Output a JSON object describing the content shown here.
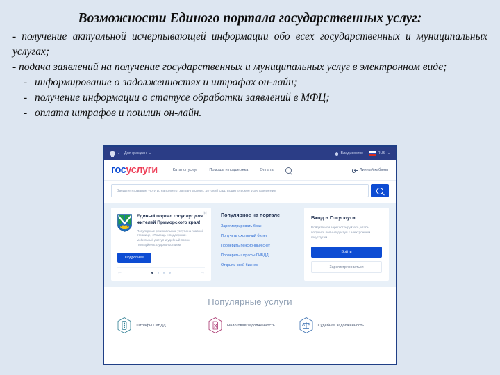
{
  "slide": {
    "headline": "Возможности Единого портала государственных услуг:",
    "bullets": [
      "- получение актуальной исчерпывающей информации обо всех государственных и муниципальных  услугах;",
      "- подача заявлений на получение государственных и муниципальных услуг в электронном виде;"
    ],
    "dash_bullets": [
      "информирование о задолженностях и штрафах он-лайн;",
      "получение информации о статусе обработки заявлений в МФЦ;",
      "оплата штрафов и пошлин он-лайн.",
      "-"
    ]
  },
  "screenshot": {
    "topbar": {
      "emblem_icon": "coat-of-arms-icon",
      "audience": "Для граждан",
      "chevron_icon": "chevron-down-icon",
      "location_icon": "map-pin-icon",
      "location": "Владивосток",
      "flag_icon": "russian-flag-icon",
      "language": "RUS"
    },
    "header": {
      "logo_gos": "гос",
      "logo_uslugi": "услуги",
      "nav": [
        "Каталог услуг",
        "Помощь и поддержка",
        "Оплата"
      ],
      "search_icon": "search-icon",
      "cabinet_icon": "key-icon",
      "cabinet": "Личный кабинет"
    },
    "search": {
      "placeholder": "Введите название услуги, например, загранпаспорт, детский сад, водительское удостоверение",
      "button_icon": "search-icon"
    },
    "banner": {
      "close_icon": "close-icon",
      "coat_icon": "primorsky-krai-coat-of-arms-icon",
      "title": "Единый портал госуслуг для жителей Приморского края!",
      "text": "Популярные региональные услуги на главной странице, «Помощь и поддержка», мобильный доступ и удобный поиск. Пользуйтесь с удовольствием!",
      "button": "Подробнее",
      "prev_icon": "arrow-left-icon",
      "next_icon": "arrow-right-icon",
      "slides": 4,
      "active_slide": 1
    },
    "popular": {
      "title": "Популярное на портале",
      "links": [
        "Зарегистрировать брак",
        "Получить охотничий билет",
        "Проверить пенсионный счет",
        "Проверить штрафы ГИБДД",
        "Открыть свой бизнес"
      ]
    },
    "login": {
      "title": "Вход в Госуслуги",
      "text": "Войдите или зарегистрируйтесь, чтобы получить полный доступ к электронным госуслугам",
      "primary": "Войти",
      "secondary": "Зарегистрироваться"
    },
    "services": {
      "title": "Популярные услуги",
      "items": [
        {
          "label": "Штрафы ГИБДД",
          "icon": "traffic-light-icon",
          "color": "#2f7f94"
        },
        {
          "label": "Налоговая задолженность",
          "icon": "tax-document-icon",
          "color": "#a8336e"
        },
        {
          "label": "Судебная задолженность",
          "icon": "scales-of-justice-icon",
          "color": "#3a6fb0"
        }
      ]
    }
  }
}
